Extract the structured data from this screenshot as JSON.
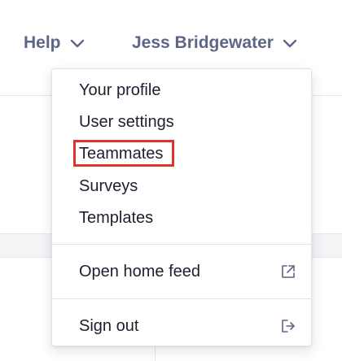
{
  "header": {
    "help_label": "Help",
    "user_name": "Jess Bridgewater"
  },
  "menu": {
    "items": [
      {
        "label": "Your profile"
      },
      {
        "label": "User settings"
      },
      {
        "label": "Teammates",
        "highlighted": true
      },
      {
        "label": "Surveys"
      },
      {
        "label": "Templates"
      }
    ],
    "open_home_feed": {
      "label": "Open home feed",
      "icon": "external-link-icon"
    },
    "sign_out": {
      "label": "Sign out",
      "icon": "sign-out-icon"
    }
  },
  "colors": {
    "nav_text": "#5f6585",
    "menu_text": "#1d1f2e",
    "highlight": "#e0322b",
    "divider": "#e1e3ea"
  }
}
